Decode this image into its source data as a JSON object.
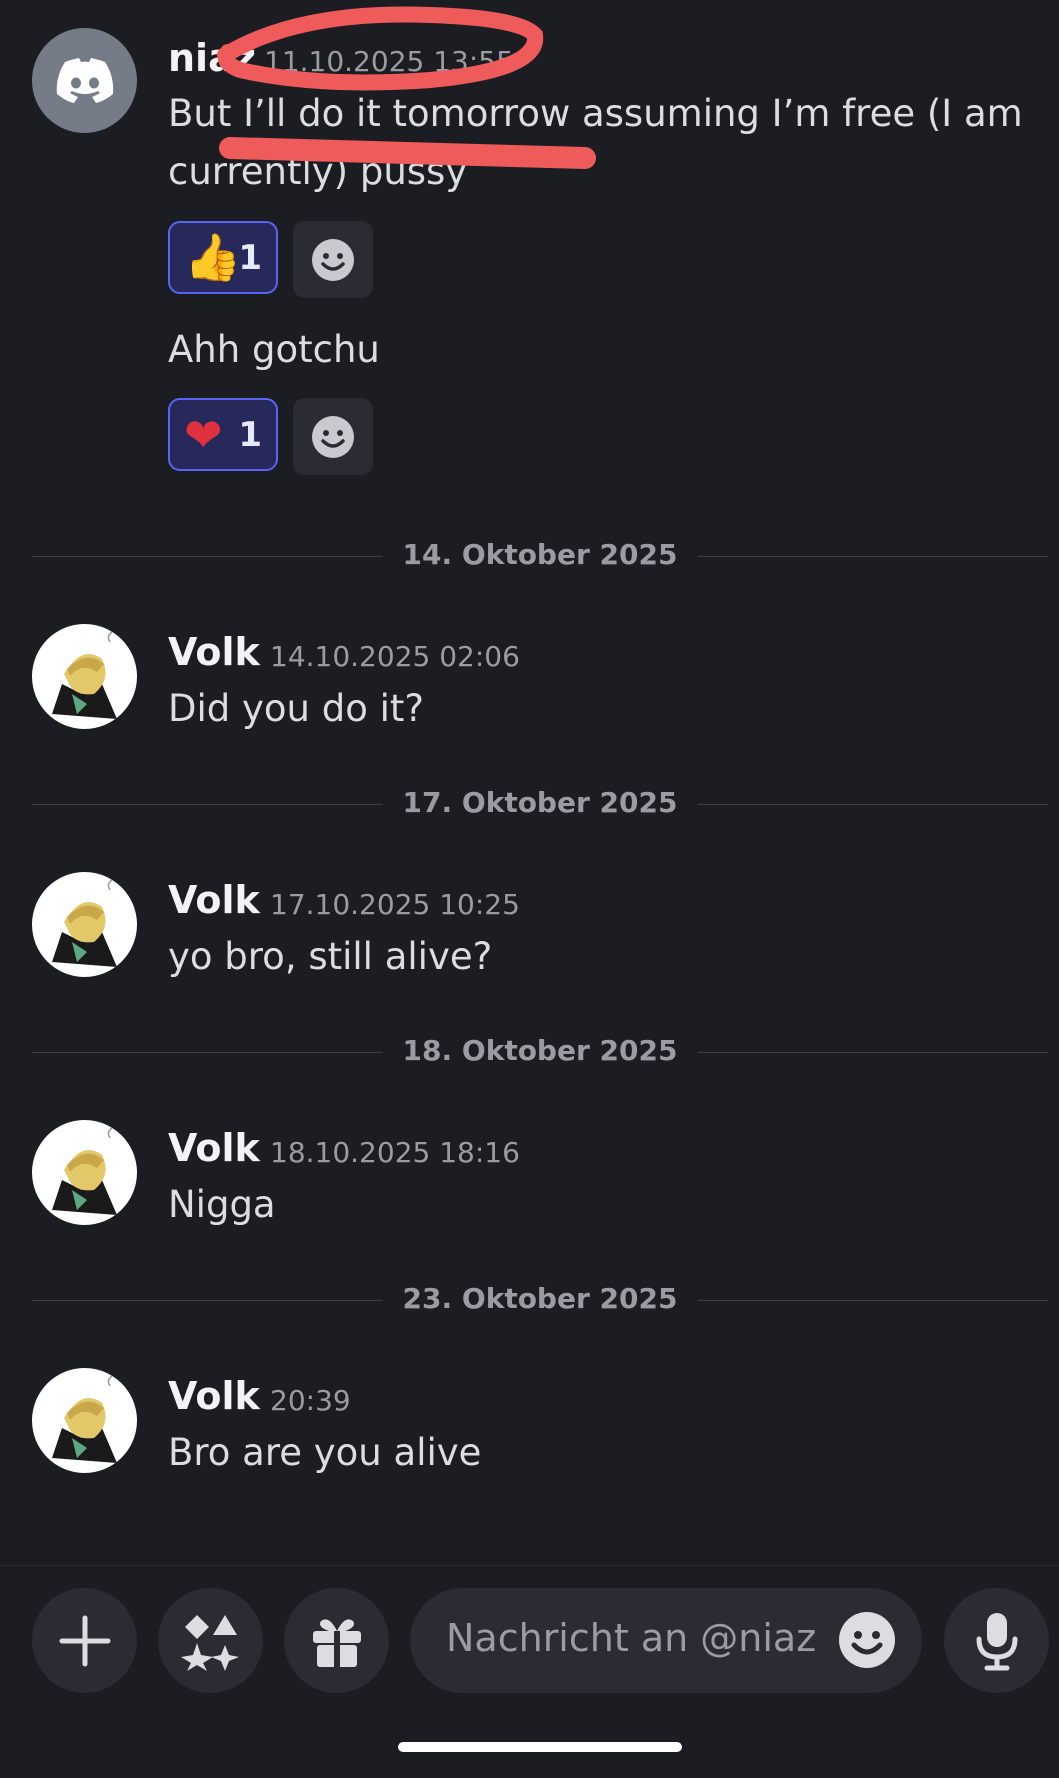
{
  "messages": [
    {
      "author": "niaz",
      "time": "11.10.2025 13:55",
      "lines": [
        "But I’ll do it tomorrow assuming I’m free (I am",
        "currently) pussy"
      ],
      "reaction": {
        "emoji": "👍",
        "count": "1"
      }
    },
    {
      "author": "",
      "time": "",
      "lines": [
        "Ahh gotchu"
      ],
      "reaction": {
        "emoji": "❤",
        "count": "1"
      }
    },
    {
      "author": "Volk",
      "time": "14.10.2025 02:06",
      "lines": [
        "Did you do it?"
      ]
    },
    {
      "author": "Volk",
      "time": "17.10.2025 10:25",
      "lines": [
        "yo bro, still alive?"
      ]
    },
    {
      "author": "Volk",
      "time": "18.10.2025 18:16",
      "lines": [
        "Nigga"
      ]
    },
    {
      "author": "Volk",
      "time": "20:39",
      "lines": [
        "Bro are you alive"
      ]
    }
  ],
  "dividers": [
    "14. Oktober 2025",
    "17. Oktober 2025",
    "18. Oktober 2025",
    "23. Oktober 2025"
  ],
  "composer": {
    "placeholder": "Nachricht an @niaz"
  },
  "icons": {
    "plus": "plus-icon",
    "apps": "apps-icon",
    "gift": "gift-icon",
    "emoji": "emoji-icon",
    "mic": "microphone-icon"
  },
  "colors": {
    "background": "#1c1d22",
    "accent": "#5865f2",
    "annotation": "#ef5a5a"
  }
}
